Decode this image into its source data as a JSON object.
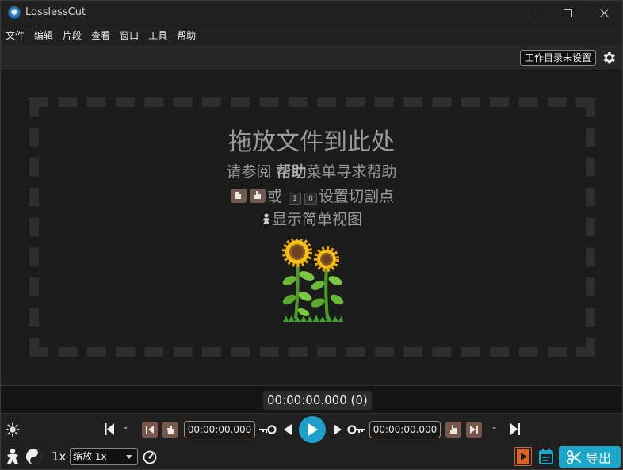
{
  "window": {
    "title": "LosslessCut"
  },
  "menu": {
    "items": [
      "文件",
      "编辑",
      "片段",
      "查看",
      "窗口",
      "工具",
      "帮助"
    ]
  },
  "toolbar": {
    "workdir_label": "工作目录未设置"
  },
  "drop_area": {
    "title": "拖放文件到此处",
    "help_prefix": "请参阅 ",
    "help_bold": "帮助",
    "help_suffix": "菜单寻求帮助",
    "keys_or": "或",
    "key_in": "I",
    "key_out": "O",
    "cut_points_text": "设置切割点",
    "simple_view_text": "显示简单视图"
  },
  "timeline": {
    "current_time": "00:00:00.000 (0)"
  },
  "controls": {
    "dash_left": "-",
    "dash_right": "-",
    "cut_start_time": "00:00:00.000",
    "cut_end_time": "00:00:00.000"
  },
  "bottom": {
    "speed": "1x",
    "zoom_value": "缩放 1x",
    "export_label": "导出"
  },
  "colors": {
    "accent": "#1aa7c9",
    "brown_button": "#76574b",
    "timefield_border": "#aa8878",
    "export_orange": "#e0621f"
  }
}
